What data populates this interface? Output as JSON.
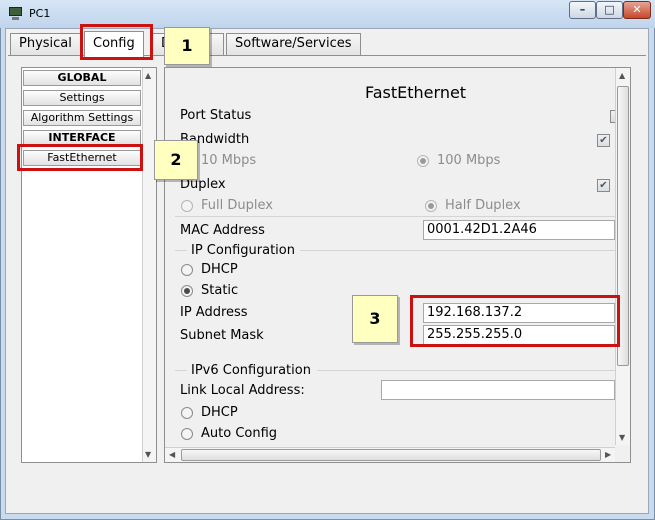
{
  "window": {
    "title": "PC1",
    "minimize_glyph": "–",
    "maximize_glyph": "□",
    "close_glyph": "✕"
  },
  "tabs": [
    {
      "label": "Physical"
    },
    {
      "label": "Config",
      "active": true
    },
    {
      "label": "D"
    },
    {
      "label": "Software/Services"
    }
  ],
  "sidebar": {
    "items": [
      {
        "label": "GLOBAL",
        "type": "header"
      },
      {
        "label": "Settings"
      },
      {
        "label": "Algorithm Settings"
      },
      {
        "label": "INTERFACE",
        "type": "header"
      },
      {
        "label": "FastEthernet",
        "selected": true
      }
    ]
  },
  "panel": {
    "title": "FastEthernet",
    "port_status": {
      "label": "Port Status",
      "checked": false
    },
    "bandwidth": {
      "label": "Bandwidth",
      "checked": true,
      "option_10": "10 Mbps",
      "option_100": "100 Mbps",
      "selected": "100 Mbps"
    },
    "duplex": {
      "label": "Duplex",
      "checked": true,
      "full": "Full Duplex",
      "half": "Half Duplex",
      "selected": "Half Duplex"
    },
    "mac": {
      "label": "MAC Address",
      "value": "0001.42D1.2A46"
    },
    "ip_config": {
      "title": "IP Configuration",
      "dhcp": "DHCP",
      "static": "Static",
      "selected": "Static"
    },
    "ip_address": {
      "label": "IP Address",
      "value": "192.168.137.2"
    },
    "subnet": {
      "label": "Subnet Mask",
      "value": "255.255.255.0"
    },
    "ipv6": {
      "title": "IPv6 Configuration",
      "link_local_label": "Link Local Address:",
      "link_local_value": "",
      "dhcp": "DHCP",
      "auto": "Auto Config"
    }
  },
  "callouts": [
    "1",
    "2",
    "3"
  ],
  "colors": {
    "callout_fill": "#ffffc0",
    "highlight_border": "#cc1111"
  }
}
